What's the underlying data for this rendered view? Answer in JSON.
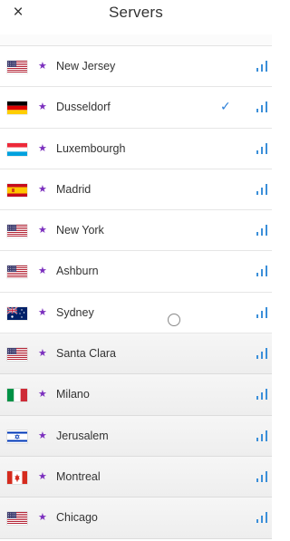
{
  "header": {
    "title": "Servers",
    "close_icon": "×"
  },
  "servers": [
    {
      "name": "New Jersey",
      "flag": "us-flag-icon",
      "favorite": true,
      "selected": false
    },
    {
      "name": "Dusseldorf",
      "flag": "de-flag-icon",
      "favorite": true,
      "selected": true
    },
    {
      "name": "Luxembourgh",
      "flag": "lu-flag-icon",
      "favorite": true,
      "selected": false
    },
    {
      "name": "Madrid",
      "flag": "es-flag-icon",
      "favorite": true,
      "selected": false
    },
    {
      "name": "New York",
      "flag": "us-flag-icon",
      "favorite": true,
      "selected": false
    },
    {
      "name": "Ashburn",
      "flag": "us-flag-icon",
      "favorite": true,
      "selected": false
    },
    {
      "name": "Sydney",
      "flag": "au-flag-icon",
      "favorite": true,
      "selected": false
    },
    {
      "name": "Santa Clara",
      "flag": "us-flag-icon",
      "favorite": true,
      "selected": false
    },
    {
      "name": "Milano",
      "flag": "it-flag-icon",
      "favorite": true,
      "selected": false
    },
    {
      "name": "Jerusalem",
      "flag": "il-flag-icon",
      "favorite": true,
      "selected": false
    },
    {
      "name": "Montreal",
      "flag": "ca-flag-icon",
      "favorite": true,
      "selected": false
    },
    {
      "name": "Chicago",
      "flag": "us-flag-icon",
      "favorite": true,
      "selected": false
    }
  ],
  "icons": {
    "star": "★",
    "check": "✓",
    "signal": "signal-icon"
  },
  "colors": {
    "star": "#7b2fbe",
    "check": "#2b7fd9",
    "signal": "#3b8fd9"
  }
}
